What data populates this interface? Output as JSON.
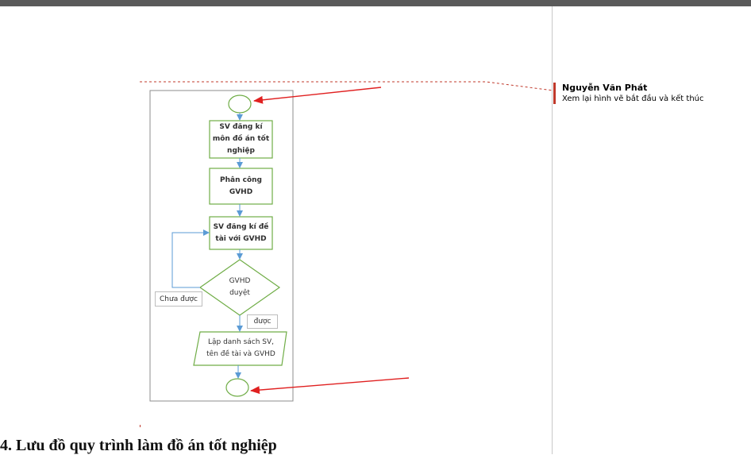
{
  "comment": {
    "author": "Nguyễn Văn Phát",
    "text": "Xem lại hình vẽ  bắt đầu và kết thúc"
  },
  "flowchart": {
    "step1": "SV đăng kí môn đồ án tốt nghiệp",
    "step2": "Phân công GVHD",
    "step3": "SV đăng kí đề tài với GVHD",
    "decision": "GVHD duyệt",
    "loop_label": "Chưa được",
    "yes_label": "được",
    "output": "Lập danh sách SV, tên đề tài và GVHD"
  },
  "document": {
    "heading": "4. Lưu đồ quy trình làm đồ án tốt nghiệp"
  },
  "colors": {
    "box_border": "#70ad47",
    "arrow": "#5b9bd5",
    "annotation_arrow": "#e02020",
    "comment_bar": "#c0392b"
  }
}
